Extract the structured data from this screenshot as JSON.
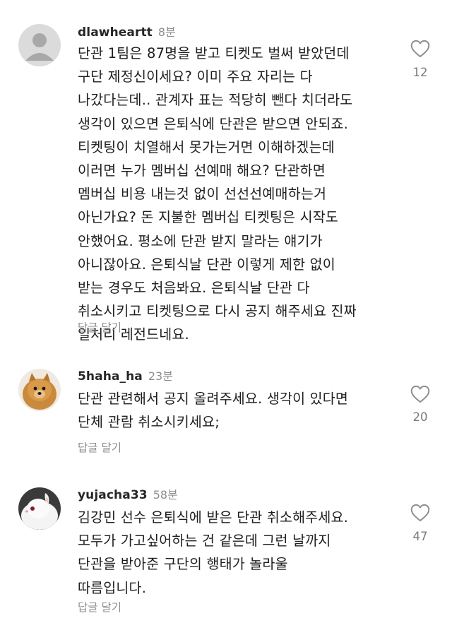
{
  "comments": [
    {
      "username": "dlawheartt",
      "time": "8분",
      "lines": [
        "단관 1팀은 87명을 받고 티켓도 벌써 받았던데",
        "구단 제정신이세요? 이미 주요 자리는 다",
        "나갔다는데.. 관계자 표는 적당히 뺀다 치더라도",
        "생각이 있으면 은퇴식에 단관은 받으면 안되죠.",
        "티켓팅이 치열해서 못가는거면 이해하겠는데",
        "이러면 누가 멤버십 선예매 해요? 단관하면",
        "멤버십 비용 내는것 없이 선선선예매하는거",
        "아닌가요? 돈 지불한 멤버십 티켓팅은 시작도",
        "안했어요. 평소에 단관 받지 말라는 얘기가",
        "아니잖아요. 은퇴식날 단관 이렇게 제한 없이",
        "받는 경우도 처음봐요. 은퇴식날 단관 다",
        "취소시키고 티켓팅으로 다시 공지 해주세요 진짜",
        "일처리 레전드네요."
      ],
      "reply_label": "답글 달기",
      "like_count": "12",
      "avatar_icon": "default-user-icon"
    },
    {
      "username": "5haha_ha",
      "time": "23분",
      "lines": [
        "단관 관련해서 공지 올려주세요. 생각이 있다면",
        "단체 관람 취소시키세요;"
      ],
      "reply_label": "답글 달기",
      "like_count": "20",
      "avatar_icon": "pomeranian-dog-photo"
    },
    {
      "username": "yujacha33",
      "time": "58분",
      "lines": [
        "김강민 선수 은퇴식에 받은 단관 취소해주세요.",
        "모두가 가고싶어하는 건 같은데 그런 날까지",
        "단관을 받아준 구단의 행태가 놀라울",
        "따름입니다."
      ],
      "reply_label": "답글 달기",
      "like_count": "47",
      "avatar_icon": "white-rabbit-photo"
    }
  ]
}
